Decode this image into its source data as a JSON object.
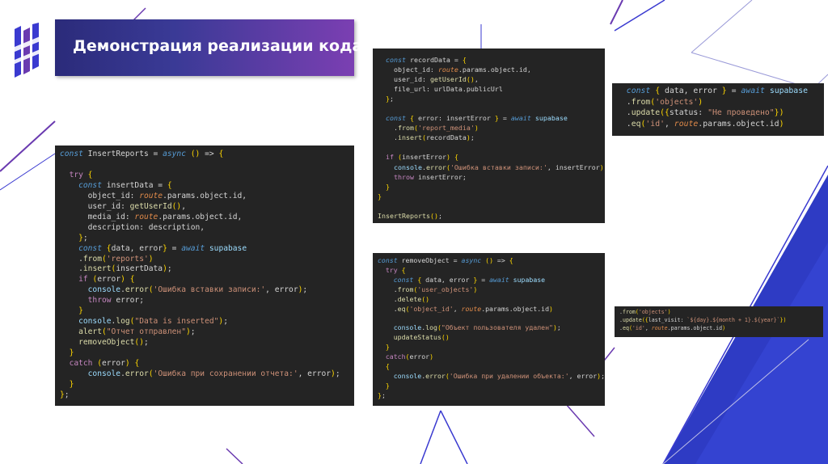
{
  "slide": {
    "title": "Демонстрация реализации кода",
    "colors": {
      "banner_start": "#2b2b7a",
      "banner_end": "#7b3fb2",
      "code_bg": "#242424"
    }
  },
  "code_blocks": [
    {
      "id": "insert-reports",
      "lines": [
        "const InsertReports = async () => {",
        "",
        "  try {",
        "    const insertData = {",
        "      object_id: route.params.object.id,",
        "      user_id: getUserId(),",
        "      media_id: route.params.object.id,",
        "      description: description,",
        "    };",
        "    const {data, error} = await supabase",
        "    .from('reports')",
        "    .insert(insertData);",
        "    if (error) {",
        "      console.error('Ошибка вставки записи:', error);",
        "      throw error;",
        "    }",
        "    console.log(\"Data is inserted\");",
        "    alert(\"Отчет отправлен\");",
        "    removeObject();",
        "  }",
        "  catch (error) {",
        "      console.error('Ошибка при сохранении отчета:', error);",
        "  }",
        "};"
      ]
    },
    {
      "id": "record-data",
      "lines": [
        "  const recordData = {",
        "    object_id: route.params.object.id,",
        "    user_id: getUserId(),",
        "    file_url: urlData.publicUrl",
        "  };",
        "",
        "  const { error: insertError } = await supabase",
        "    .from('report_media')",
        "    .insert(recordData);",
        "",
        "  if (insertError) {",
        "    console.error('Ошибка вставки записи:', insertError);",
        "    throw insertError;",
        "  }",
        "}",
        "",
        "InsertReports();"
      ]
    },
    {
      "id": "remove-object",
      "lines": [
        "const removeObject = async () => {",
        "  try {",
        "    const { data, error } = await supabase",
        "    .from('user_objects')",
        "    .delete()",
        "    .eq('object_id', route.params.object.id)",
        "",
        "    console.log(\"Объект пользователя удален\");",
        "    updateStatus()",
        "  }",
        "  catch(error)",
        "  {",
        "    console.error('Ошибка при удалении объекта:', error);",
        "  }",
        "};"
      ]
    },
    {
      "id": "update-status",
      "lines": [
        "  const { data, error } = await supabase",
        "  .from('objects')",
        "  .update({status: \"Не проведено\"})",
        "  .eq('id', route.params.object.id)"
      ]
    },
    {
      "id": "update-last-visit",
      "lines": [
        ".from('objects')",
        ".update({last_visit: `${day}.${month + 1}.${year}`})",
        ".eq('id', route.params.object.id)"
      ]
    }
  ]
}
